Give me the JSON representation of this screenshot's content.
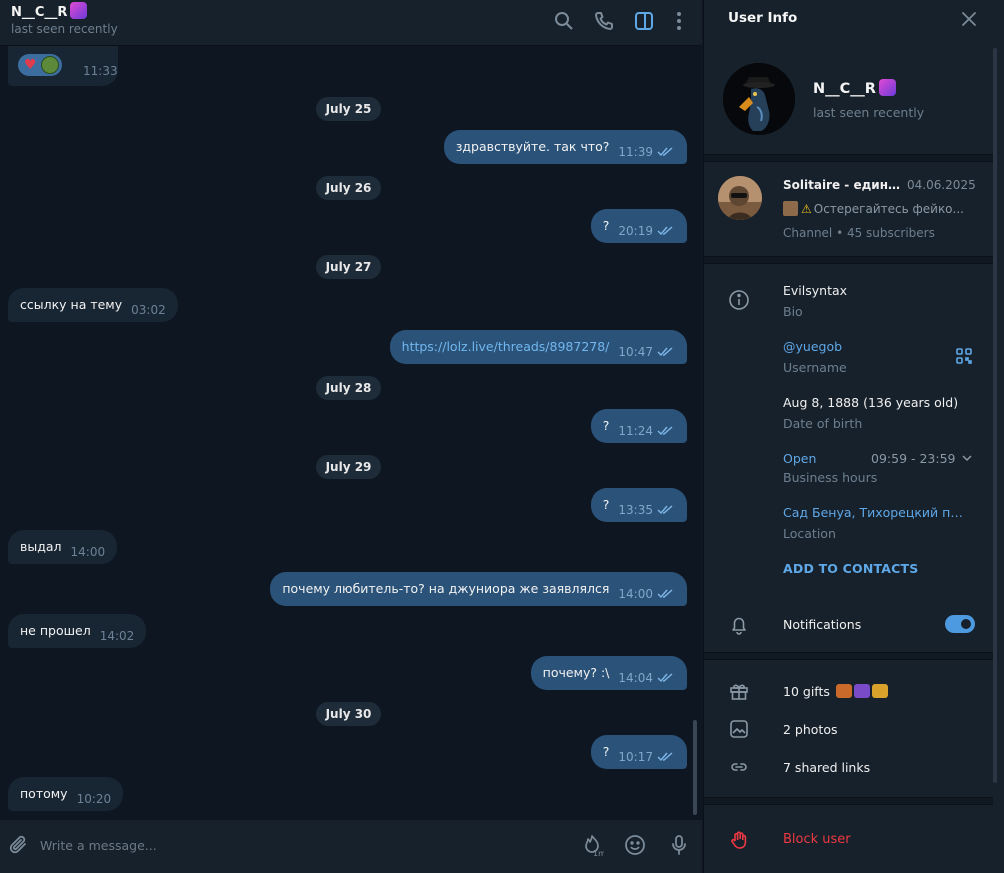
{
  "chat": {
    "peer_name": "N__C__R",
    "peer_status": "last seen recently",
    "reaction_time": "11:33",
    "date_pills": [
      "July 25",
      "July 26",
      "July 27",
      "July 28",
      "July 29",
      "July 30"
    ],
    "messages": [
      {
        "text": "здравствуйте. так что?",
        "time": "11:39",
        "dir": "out"
      },
      {
        "text": "?",
        "time": "20:19",
        "dir": "out"
      },
      {
        "text": "ссылку на тему",
        "time": "03:02",
        "dir": "in"
      },
      {
        "text": "https://lolz.live/threads/8987278/",
        "time": "10:47",
        "dir": "out"
      },
      {
        "text": "?",
        "time": "11:24",
        "dir": "out"
      },
      {
        "text": "?",
        "time": "13:35",
        "dir": "out"
      },
      {
        "text": "выдал",
        "time": "14:00",
        "dir": "in"
      },
      {
        "text": "почему любитель-то? на джуниора же заявлялся",
        "time": "14:00",
        "dir": "out"
      },
      {
        "text": "не прошел",
        "time": "14:02",
        "dir": "in"
      },
      {
        "text": "почему? :\\",
        "time": "14:04",
        "dir": "out"
      },
      {
        "text": "?",
        "time": "10:17",
        "dir": "out"
      },
      {
        "text": "потому",
        "time": "10:20",
        "dir": "in"
      }
    ],
    "composer_placeholder": "Write a message..."
  },
  "info": {
    "title": "User Info",
    "name": "N__C__R",
    "status": "last seen recently",
    "channel": {
      "name": "Solitaire - единс...",
      "date": "04.06.2025",
      "preview": "Остерегайтесь фейко...",
      "meta": "Channel • 45 subscribers"
    },
    "bio": {
      "value": "Evilsyntax",
      "label": "Bio"
    },
    "username": {
      "value": "@yuegob",
      "label": "Username"
    },
    "birth": {
      "value": "Aug 8, 1888 (136 years old)",
      "label": "Date of birth"
    },
    "business": {
      "state": "Open",
      "hours": "09:59 - 23:59",
      "label": "Business hours"
    },
    "location": {
      "value": "Сад Бенуа, Тихорецкий пр....",
      "label": "Location"
    },
    "add_contacts": "ADD TO CONTACTS",
    "notifications": {
      "label": "Notifications",
      "enabled": true
    },
    "gifts": "10 gifts",
    "photos": "2 photos",
    "links": "7 shared links",
    "block": "Block user"
  },
  "colors": {
    "accent": "#5ea8e8",
    "outgoing_bubble": "#2b5278",
    "incoming_bubble": "#182533",
    "danger": "#ec3942"
  }
}
